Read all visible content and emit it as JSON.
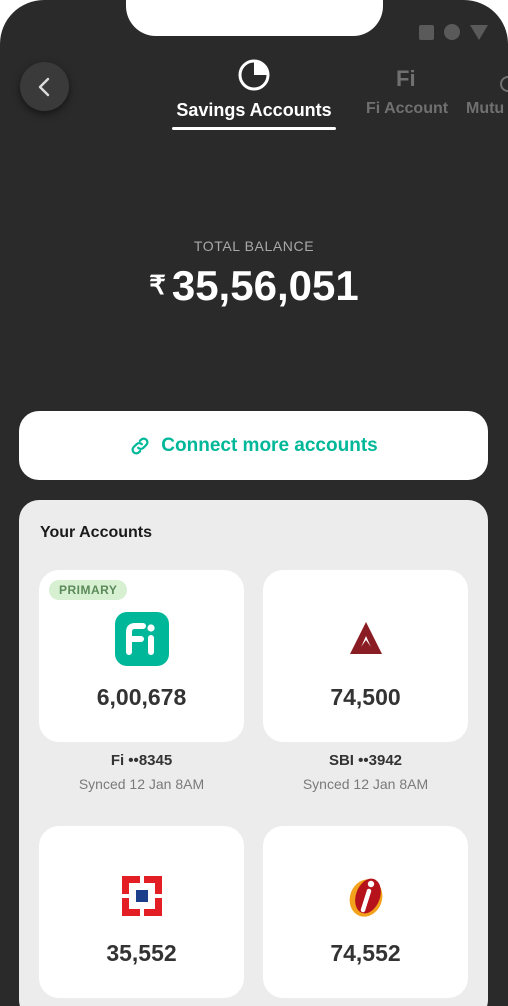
{
  "nav": {
    "tabs": [
      {
        "label": "Savings Accounts"
      },
      {
        "label": "Fi Account"
      },
      {
        "label": "Mutu"
      }
    ]
  },
  "summary": {
    "total_label": "TOTAL BALANCE",
    "currency_symbol": "₹",
    "total_amount": "35,56,051"
  },
  "connect": {
    "label": "Connect more accounts"
  },
  "accounts_section": {
    "title": "Your Accounts",
    "items": [
      {
        "badge": "PRIMARY",
        "balance": "6,00,678",
        "name": "Fi ••8345",
        "synced": "Synced 12 Jan 8AM"
      },
      {
        "balance": "74,500",
        "name": "SBI ••3942",
        "synced": "Synced 12 Jan 8AM"
      },
      {
        "balance": "35,552"
      },
      {
        "balance": "74,552"
      }
    ]
  },
  "colors": {
    "background": "#2a2a2a",
    "accent": "#00b899",
    "panel": "#ececed"
  }
}
